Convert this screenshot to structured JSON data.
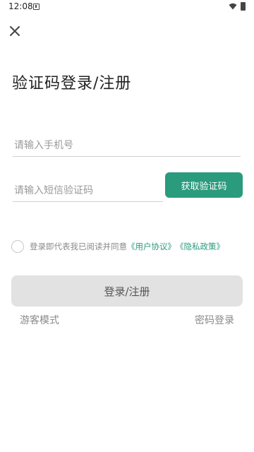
{
  "status_bar": {
    "time": "12:08"
  },
  "icons": {
    "close": "close-icon",
    "wifi": "wifi-icon",
    "battery": "battery-icon",
    "notification": "notification-icon",
    "checkbox": "radio-circle-icon"
  },
  "header": {
    "title": "验证码登录/注册"
  },
  "form": {
    "phone_placeholder": "请输入手机号",
    "phone_value": "",
    "code_placeholder": "请输入短信验证码",
    "code_value": "",
    "get_code_label": "获取验证码"
  },
  "agreement": {
    "checked": false,
    "prefix": "登录即代表我已阅读并同意",
    "user_agreement": "《用户协议》",
    "privacy_policy": "《隐私政策》"
  },
  "actions": {
    "login_label": "登录/注册",
    "guest_label": "游客模式",
    "password_login_label": "密码登录"
  },
  "colors": {
    "accent": "#2a9b7d",
    "disabled_button": "#e2e2e2",
    "hint_text": "#8a8a8a",
    "background": "#ffffff"
  }
}
